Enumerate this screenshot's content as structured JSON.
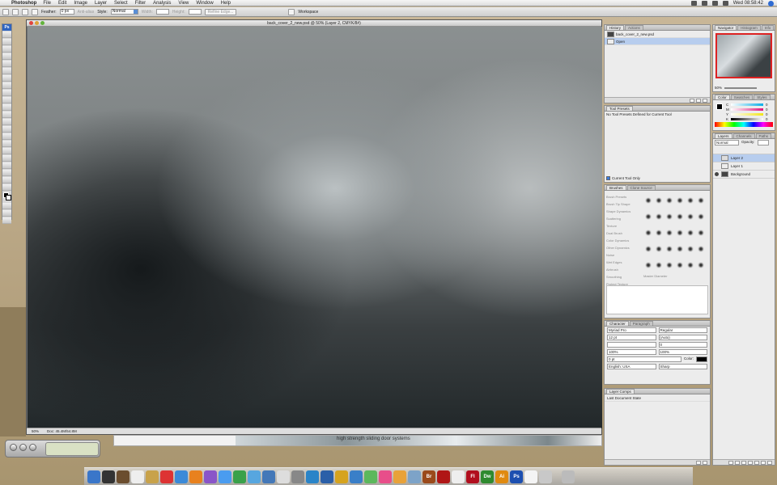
{
  "menubar": {
    "app": "Photoshop",
    "items": [
      "File",
      "Edit",
      "Image",
      "Layer",
      "Select",
      "Filter",
      "Analysis",
      "View",
      "Window",
      "Help"
    ],
    "clock": "Wed 08:58:42"
  },
  "options": {
    "feather_label": "Feather:",
    "feather_value": "0 px",
    "anti_alias": "Anti-alias",
    "style_label": "Style:",
    "style_value": "Normal",
    "width_label": "Width:",
    "height_label": "Height:",
    "refine": "Refine Edge...",
    "workspace": "Workspace"
  },
  "document": {
    "title": "back_cover_2_new.psd @ 50% (Layer 2, CMYK/8#)",
    "zoom": "50%",
    "doc_size": "Doc: 45.4M/54.8M",
    "caption": "high strength sliding door systems"
  },
  "history": {
    "tabs": [
      "History",
      "Actions"
    ],
    "rows": [
      "back_cover_2_new.psd",
      "Open"
    ]
  },
  "navigator": {
    "tabs": [
      "Navigator",
      "Histogram",
      "Info"
    ],
    "zoom": "50%"
  },
  "color": {
    "tabs": [
      "Color",
      "Swatches",
      "Styles"
    ],
    "channels": [
      "C",
      "M",
      "Y",
      "K"
    ],
    "values": [
      "0",
      "0",
      "0",
      "0"
    ]
  },
  "layers": {
    "tabs": [
      "Layers",
      "Channels",
      "Paths"
    ],
    "mode": "Normal",
    "opacity_label": "Opacity:",
    "rows": [
      {
        "name": "Layer 2",
        "selected": true
      },
      {
        "name": "Layer 1",
        "selected": false
      },
      {
        "name": "Background",
        "selected": false
      }
    ]
  },
  "tool_presets": {
    "tab": "Tool Presets",
    "message": "No Tool Presets Defined for Current Tool",
    "checkbox": "Current Tool Only"
  },
  "brushes": {
    "tabs": [
      "Brushes",
      "Clone Source"
    ],
    "list": [
      "Brush Presets",
      "Brush Tip Shape",
      "Shape Dynamics",
      "Scattering",
      "Texture",
      "Dual Brush",
      "Color Dynamics",
      "Other Dynamics",
      "Noise",
      "Wet Edges",
      "Airbrush",
      "Smoothing",
      "Protect Texture"
    ],
    "master_diameter": "Master Diameter"
  },
  "character": {
    "tabs": [
      "Character",
      "Paragraph"
    ],
    "font": "Myriad Pro",
    "style": "Regular",
    "size": "12 pt",
    "leading": "(Auto)",
    "kerning": "",
    "tracking": "0",
    "scale_v": "100%",
    "scale_h": "100%",
    "baseline": "0 pt",
    "color_label": "Color:",
    "language": "English: USA",
    "aa": "Sharp"
  },
  "layer_comps": {
    "tab": "Layer Comps",
    "row": "Last Document State"
  },
  "dock": {
    "icons": [
      {
        "label": "Br",
        "color": "#9b4a1b"
      },
      {
        "label": "",
        "color": "#b01616"
      },
      {
        "label": "Fl",
        "color": "#b10e1e"
      },
      {
        "label": "Dw",
        "color": "#2f8a2f"
      },
      {
        "label": "Ai",
        "color": "#e08a10"
      },
      {
        "label": "Ps",
        "color": "#1d4fb0"
      }
    ]
  }
}
